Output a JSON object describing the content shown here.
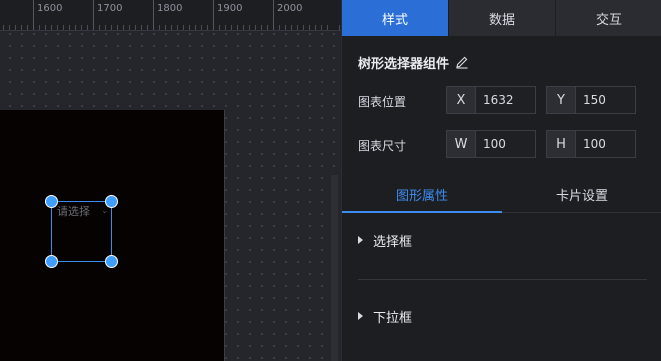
{
  "ruler": {
    "labels": [
      "1600",
      "1700",
      "1800",
      "1900",
      "2000"
    ]
  },
  "canvas": {
    "widget_placeholder": "请选择"
  },
  "panel": {
    "tabs": [
      {
        "label": "样式",
        "active": true
      },
      {
        "label": "数据",
        "active": false
      },
      {
        "label": "交互",
        "active": false
      }
    ],
    "component_title": "树形选择器组件",
    "position": {
      "label": "图表位置",
      "x_prefix": "X",
      "x_value": "1632",
      "y_prefix": "Y",
      "y_value": "150"
    },
    "size": {
      "label": "图表尺寸",
      "w_prefix": "W",
      "w_value": "100",
      "h_prefix": "H",
      "h_value": "100"
    },
    "subtabs": [
      {
        "label": "图形属性",
        "active": true
      },
      {
        "label": "卡片设置",
        "active": false
      }
    ],
    "sections": [
      {
        "label": "选择框"
      },
      {
        "label": "下拉框"
      }
    ]
  },
  "colors": {
    "accent": "#2b6fd6",
    "active_text": "#3d8cf0",
    "handle": "#409eff"
  }
}
